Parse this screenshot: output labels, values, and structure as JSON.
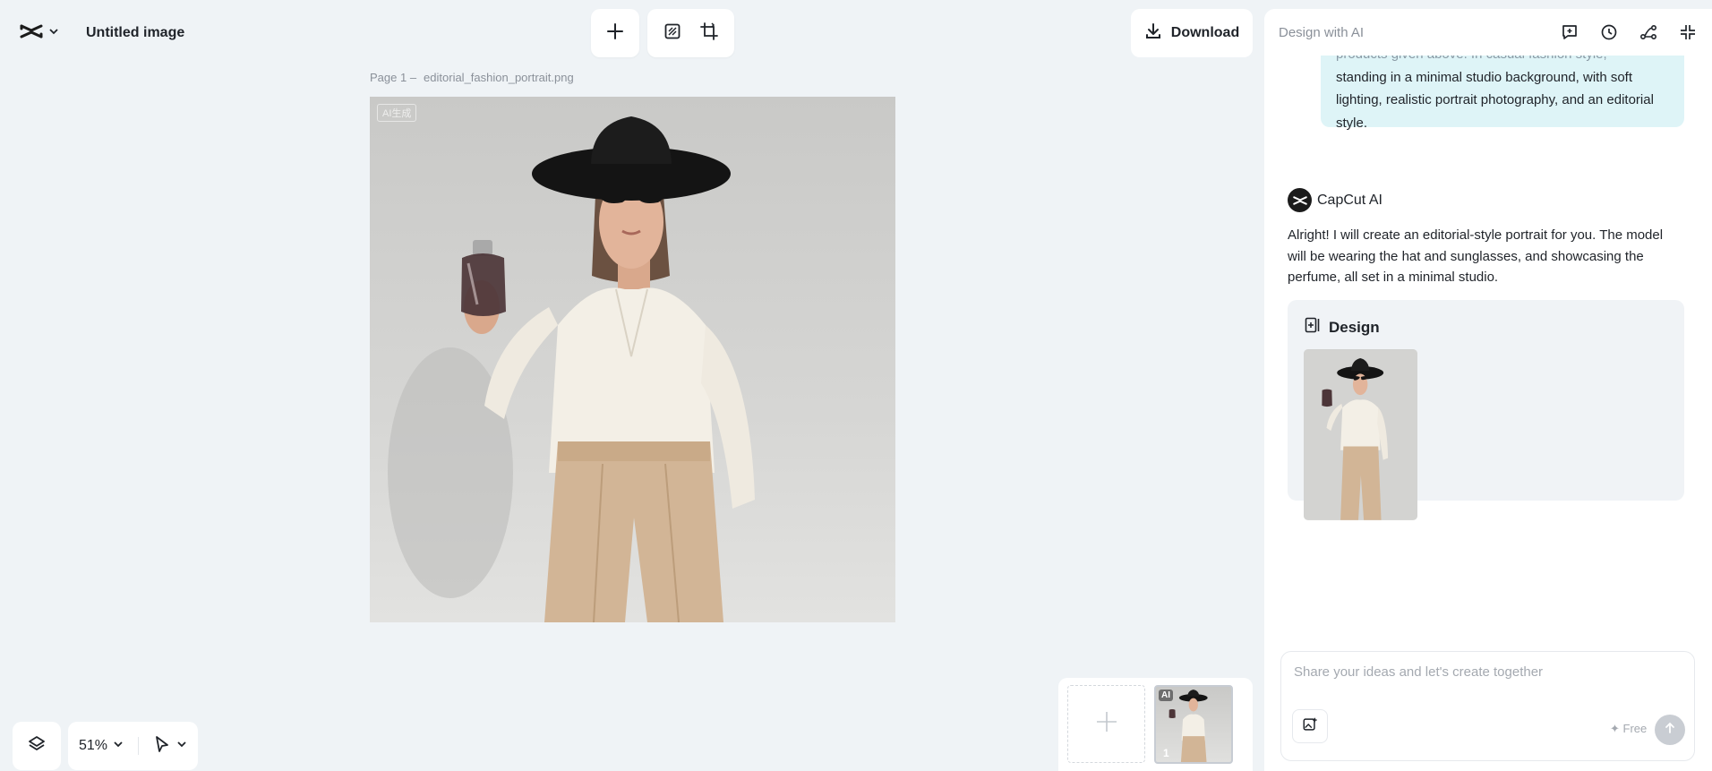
{
  "header": {
    "logo_icon": "capcut-logo-icon",
    "doc_title": "Untitled image"
  },
  "toolbar": {
    "add_icon": "plus-icon",
    "resize_icon": "aspect-ratio-icon",
    "crop_icon": "crop-icon",
    "download_label": "Download"
  },
  "canvas": {
    "page_label": "Page 1 –",
    "file_name": "editorial_fashion_portrait.png",
    "ai_tag": "AI生成"
  },
  "bottom_controls": {
    "zoom": "51%"
  },
  "pages": {
    "thumb_badge": "AI",
    "thumb_number": "1"
  },
  "panel": {
    "title": "Design with AI",
    "user_message_faded": "products given above. In casual fashion style,",
    "user_message": "standing in a minimal studio background, with soft lighting, realistic portrait photography, and an editorial style.",
    "ai_name": "CapCut AI",
    "ai_reply": "Alright! I will create an editorial-style portrait for you. The model will be wearing the hat and sunglasses, and showcasing the perfume, all set in a minimal studio.",
    "design_title": "Design",
    "input_placeholder": "Share your ideas and let's create together",
    "free_label": "✦ Free"
  },
  "colors": {
    "background": "#eff3f6",
    "user_bubble": "#def4f7",
    "card": "#f0f3f6",
    "send_disabled": "#c9cdd3"
  }
}
